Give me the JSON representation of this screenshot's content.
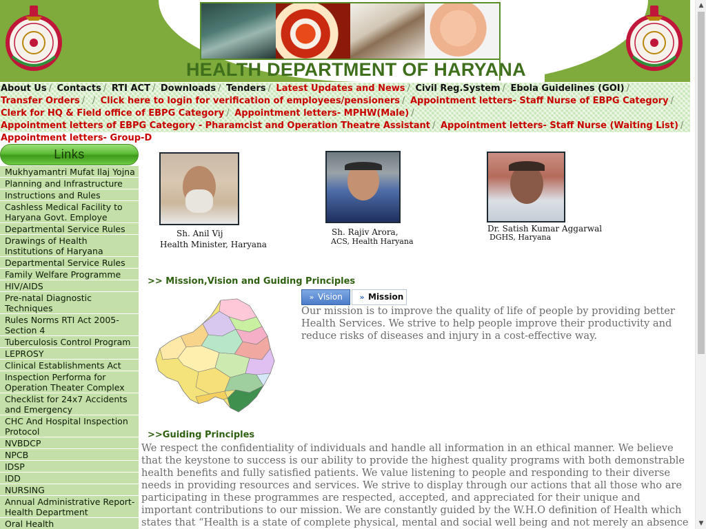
{
  "header": {
    "title": "HEALTH DEPARTMENT OF HARYANA",
    "emblem_left": "haryana-emblem-icon",
    "emblem_right": "haryana-emblem-icon",
    "banner_photos": [
      "surgery-photo",
      "pills-photo",
      "injection-photo",
      "baby-photo"
    ]
  },
  "topnav": {
    "items": [
      {
        "label": "About Us",
        "color": "#111111"
      },
      {
        "label": "Contacts",
        "color": "#111111"
      },
      {
        "label": "RTI ACT",
        "color": "#111111"
      },
      {
        "label": "Downloads",
        "color": "#111111"
      },
      {
        "label": "Tenders",
        "color": "#111111"
      },
      {
        "label": "Latest Updates and News",
        "color": "#c80000"
      },
      {
        "label": "Civil Reg.System",
        "color": "#111111"
      },
      {
        "label": "Ebola Guidelines (GOI)",
        "color": "#111111"
      },
      {
        "label": "Transfer Orders",
        "color": "#c80000"
      },
      {
        "label": "Click here to login for verification of employees/pensioners",
        "color": "#c80000"
      },
      {
        "label": "Appointment letters- Staff Nurse of EBPG Category",
        "color": "#c80000"
      },
      {
        "label": "Clerk for HQ & Field office of EBPG Category",
        "color": "#c80000"
      },
      {
        "label": "Appointment letters- MPHW(Male)",
        "color": "#c80000"
      },
      {
        "label": "Appointment letters of EBPG Category - Pharamcist and Operation Theatre Assistant",
        "color": "#c80000"
      },
      {
        "label": "Appointment letters- Staff Nurse (Waiting List)",
        "color": "#c80000"
      },
      {
        "label": "Appointment letters- Group-D",
        "color": "#c80000"
      }
    ]
  },
  "sidebar": {
    "header": "Links",
    "items": [
      "Mukhyamantri Mufat Ilaj Yojna",
      "Planning and Infrastructure",
      "Instructions and Rules",
      "Cashless Medical Facility to Haryana Govt. Employe",
      "Departmental Service Rules",
      "Drawings of Health Institutions of Haryana",
      "Departmental Service Rules",
      "Family Welfare Programme",
      "HIV/AIDS",
      "Pre-natal Diagnostic Techniques",
      "Rules Norms RTI Act 2005-Section 4",
      "Tuberculosis Control Program",
      "LEPROSY",
      "Clinical Establishments Act",
      "Inspection Performa for Operation Theater Complex",
      "Checklist for 24x7 Accidents and Emergency",
      "CHC And Hospital Inspection Protocol",
      "NVBDCP",
      "NPCB",
      "IDSP",
      "IDD",
      "NURSING",
      "Annual Administrative Report-Health Department",
      "Oral Health"
    ]
  },
  "officials": {
    "minister": {
      "name": "Sh. Anil Vij",
      "designation": "Health Minister, Haryana"
    },
    "acs": {
      "name": "Sh. Rajiv Arora,",
      "designation": "ACS, Health Haryana"
    },
    "dghs": {
      "name": "Dr. Satish Kumar Aggarwal",
      "designation": "DGHS, Haryana"
    }
  },
  "mission": {
    "heading": ">> Mission,Vision and Guiding Principles",
    "tabs": [
      {
        "label": "Vision",
        "active": true
      },
      {
        "label": "Mission",
        "active": false
      }
    ],
    "tab_icon": "double-chevron-right-icon",
    "text": "Our mission is to improve the quality of life of people by providing better Health Services. We strive to help people improve their productivity and reduce risks of diseases and injury in a cost-effective way.",
    "map": "haryana-district-map"
  },
  "principles": {
    "heading": ">>Guiding Principles",
    "text": "We respect the confidentiality of individuals and handle all information in an ethical manner. We believe that the keystone to success is our ability to provide the highest quality programs with both demonstrable health benefits and fully satisfied patients. We value listening to people and responding to their diverse needs in providing resources and services. We strive to display through our actions that all those who are participating in these programmes are respected, accepted, and appreciated for their unique and important contributions to our mission. We are constantly guided by the W.H.O definition of Health which states that “Health is a state of complete physical, mental and social well being and not merely an absence of disease or infirmity ."
  },
  "colors": {
    "header_green": "#7faa3c",
    "nav_red": "#c80000",
    "sidebar_item_bg": "#c4e0a8",
    "section_heading": "#2f6010",
    "body_text": "#6b6b6b"
  }
}
